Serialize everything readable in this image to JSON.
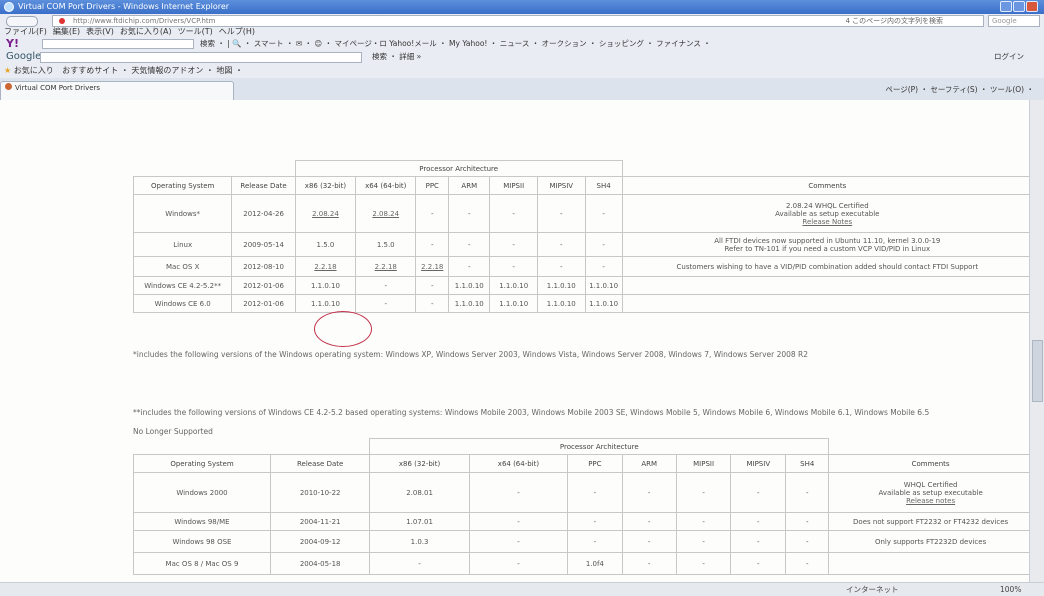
{
  "window": {
    "title": "Virtual COM Port Drivers - Windows Internet Explorer"
  },
  "address": {
    "url": "http://www.ftdichip.com/Drivers/VCP.htm",
    "right_text": "4 このページ内の文字列を検索",
    "search_placeholder": "Google"
  },
  "menu": [
    "ファイル(F)",
    "編集(E)",
    "表示(V)",
    "お気に入り(A)",
    "ツール(T)",
    "ヘルプ(H)"
  ],
  "yahoo_toolbar": {
    "logo": "Y!",
    "items": "検索 ・ | 🔍 ・ スマート ・ ✉ ・ 😊 ・ マイページ・ロ Yahoo!メール ・ My Yahoo! ・ ニュース ・ オークション ・ ショッピング ・ ファイナンス ・"
  },
  "google_toolbar": {
    "label": "Google",
    "search_btn": "検索 ・ 詳細 »",
    "login": "ログイン"
  },
  "favorites": {
    "label": "お気に入り",
    "items": "おすすめサイト ・ 天気情報のアドオン ・ 地図 ・"
  },
  "tab": {
    "label": "Virtual COM Port Drivers"
  },
  "tab_tools": "ページ(P) ・ セーフティ(S) ・ ツール(O) ・",
  "current_table": {
    "arch_header": "Processor Architecture",
    "headers": [
      "Operating System",
      "Release Date",
      "x86 (32-bit)",
      "x64 (64-bit)",
      "PPC",
      "ARM",
      "MIPSII",
      "MIPSIV",
      "SH4",
      "Comments"
    ],
    "rows": [
      {
        "os": "Windows*",
        "date": "2012-04-26",
        "x86": "2.08.24",
        "x64": "2.08.24",
        "ppc": "-",
        "arm": "-",
        "mips2": "-",
        "mips4": "-",
        "sh4": "-",
        "comments": [
          "2.08.24 WHQL Certified",
          "Available as setup executable",
          "Release Notes"
        ]
      },
      {
        "os": "Linux",
        "date": "2009-05-14",
        "x86": "1.5.0",
        "x64": "1.5.0",
        "ppc": "-",
        "arm": "-",
        "mips2": "-",
        "mips4": "-",
        "sh4": "-",
        "comments": [
          "All FTDI devices now supported in Ubuntu 11.10, kernel 3.0.0-19",
          "Refer to TN-101 if you need a custom VCP VID/PID in Linux"
        ]
      },
      {
        "os": "Mac OS X",
        "date": "2012-08-10",
        "x86": "2.2.18",
        "x64": "2.2.18",
        "ppc": "2.2.18",
        "arm": "-",
        "mips2": "-",
        "mips4": "-",
        "sh4": "-",
        "comments": [
          "Customers wishing to have a VID/PID combination added should contact FTDI Support"
        ]
      },
      {
        "os": "Windows CE 4.2-5.2**",
        "date": "2012-01-06",
        "x86": "1.1.0.10",
        "x64": "-",
        "ppc": "-",
        "arm": "1.1.0.10",
        "mips2": "1.1.0.10",
        "mips4": "1.1.0.10",
        "sh4": "1.1.0.10",
        "comments": []
      },
      {
        "os": "Windows CE 6.0",
        "date": "2012-01-06",
        "x86": "1.1.0.10",
        "x64": "-",
        "ppc": "-",
        "arm": "1.1.0.10",
        "mips2": "1.1.0.10",
        "mips4": "1.1.0.10",
        "sh4": "1.1.0.10",
        "comments": []
      }
    ]
  },
  "notes": {
    "n1": "*includes the following versions of the Windows operating system: Windows XP, Windows Server 2003, Windows Vista, Windows Server 2008, Windows 7, Windows Server 2008 R2",
    "n2": "**includes the following versions of Windows CE 4.2-5.2 based operating systems: Windows Mobile 2003, Windows Mobile 2003 SE, Windows Mobile 5, Windows Mobile 6, Windows Mobile 6.1, Windows Mobile 6.5"
  },
  "legacy": {
    "title": "No Longer Supported",
    "arch_header": "Processor Architecture",
    "headers": [
      "Operating System",
      "Release Date",
      "x86 (32-bit)",
      "x64 (64-bit)",
      "PPC",
      "ARM",
      "MIPSII",
      "MIPSIV",
      "SH4",
      "Comments"
    ],
    "rows": [
      {
        "os": "Windows 2000",
        "date": "2010-10-22",
        "x86": "2.08.01",
        "x64": "-",
        "ppc": "-",
        "arm": "-",
        "mips2": "-",
        "mips4": "-",
        "sh4": "-",
        "comments": [
          "WHQL Certified",
          "Available as setup executable",
          "Release notes"
        ]
      },
      {
        "os": "Windows 98/ME",
        "date": "2004-11-21",
        "x86": "1.07.01",
        "x64": "-",
        "ppc": "-",
        "arm": "-",
        "mips2": "-",
        "mips4": "-",
        "sh4": "-",
        "comments": [
          "Does not support FT2232 or FT4232 devices"
        ]
      },
      {
        "os": "Windows 98 OSE",
        "date": "2004-09-12",
        "x86": "1.0.3",
        "x64": "-",
        "ppc": "-",
        "arm": "-",
        "mips2": "-",
        "mips4": "-",
        "sh4": "-",
        "comments": [
          "Only supports FT2232D devices"
        ]
      },
      {
        "os": "Mac OS 8 / Mac OS 9",
        "date": "2004-05-18",
        "x86": "-",
        "x64": "-",
        "ppc": "1.0f4",
        "arm": "-",
        "mips2": "-",
        "mips4": "-",
        "sh4": "-",
        "comments": []
      }
    ]
  },
  "status": {
    "zone": "インターネット",
    "zoom": "100%"
  }
}
